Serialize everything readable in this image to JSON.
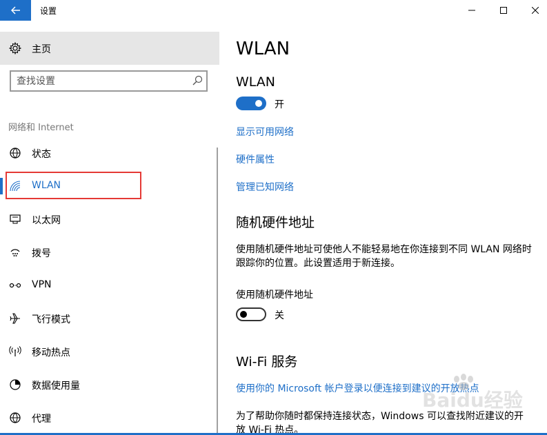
{
  "window": {
    "title": "设置",
    "back_icon": "arrow-left-icon",
    "accent_color": "#1e6fc8"
  },
  "sidebar": {
    "home_label": "主页",
    "home_icon": "gear-icon",
    "search_placeholder": "查找设置",
    "section_label": "网络和 Internet",
    "items": [
      {
        "label": "状态",
        "icon": "globe-icon"
      },
      {
        "label": "WLAN",
        "icon": "wifi-icon",
        "selected": true
      },
      {
        "label": "以太网",
        "icon": "ethernet-icon"
      },
      {
        "label": "拨号",
        "icon": "dialup-icon"
      },
      {
        "label": "VPN",
        "icon": "vpn-icon"
      },
      {
        "label": "飞行模式",
        "icon": "airplane-icon"
      },
      {
        "label": "移动热点",
        "icon": "hotspot-icon"
      },
      {
        "label": "数据使用量",
        "icon": "data-usage-icon"
      },
      {
        "label": "代理",
        "icon": "proxy-globe-icon"
      }
    ]
  },
  "main": {
    "title": "WLAN",
    "wlan_heading": "WLAN",
    "wlan_toggle": {
      "state": "on",
      "label": "开"
    },
    "links": {
      "show_networks": "显示可用网络",
      "hardware_props": "硬件属性",
      "manage_known": "管理已知网络"
    },
    "random_mac": {
      "heading": "随机硬件地址",
      "description": "使用随机硬件地址可使他人不能轻易地在你连接到不同 WLAN 网络时跟踪你的位置。此设置适用于新连接。",
      "field_label": "使用随机硬件地址",
      "toggle": {
        "state": "off",
        "label": "关"
      }
    },
    "wifi_services": {
      "heading": "Wi-Fi 服务",
      "link": "使用你的 Microsoft 帐户登录以便连接到建议的开放热点",
      "description": "为了帮助你随时都保持连接状态，Windows 可以查找附近建议的开放 Wi-Fi 热点。"
    }
  },
  "watermark": {
    "text": "Baidu经验"
  }
}
